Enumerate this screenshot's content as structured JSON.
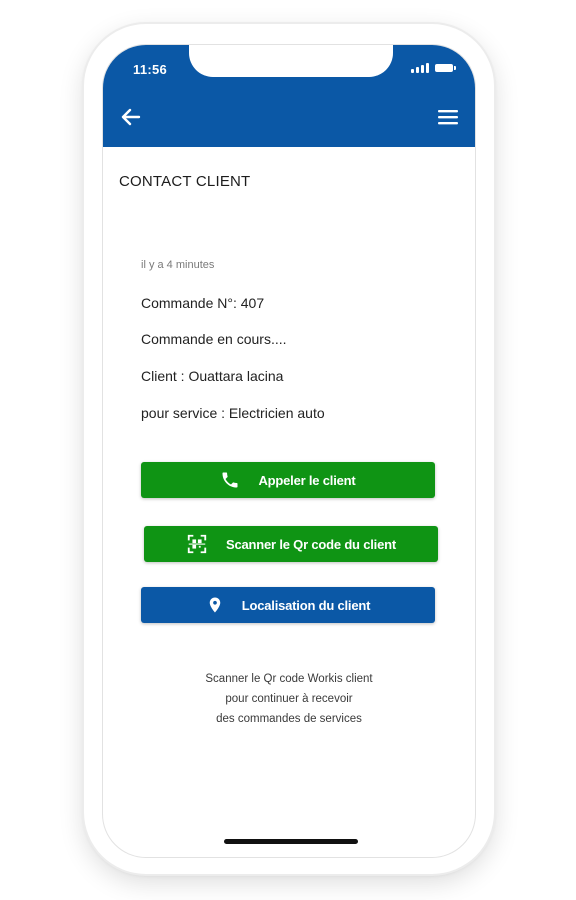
{
  "status_bar": {
    "time": "11:56"
  },
  "header": {
    "back_icon": "arrow-left-icon",
    "menu_icon": "hamburger-menu-icon",
    "background": "#0b58a6"
  },
  "page": {
    "title": "CONTACT CLIENT"
  },
  "order": {
    "timestamp": "il y a 4 minutes",
    "number_line": "Commande N°: 407",
    "status_line": "Commande en cours....",
    "client_line": "Client : Ouattara lacina",
    "service_line": "pour service : Electricien auto"
  },
  "actions": {
    "call": {
      "label": "Appeler le client",
      "icon": "phone-icon",
      "color": "#0f9414"
    },
    "scan": {
      "label": "Scanner le Qr code du client",
      "icon": "qr-scan-icon",
      "color": "#0f9414"
    },
    "locate": {
      "label": "Localisation du client",
      "icon": "location-pin-icon",
      "color": "#0b58a6"
    }
  },
  "hint": {
    "line1": "Scanner le Qr code Workis client",
    "line2": "pour continuer à recevoir",
    "line3": "des commandes de services"
  }
}
